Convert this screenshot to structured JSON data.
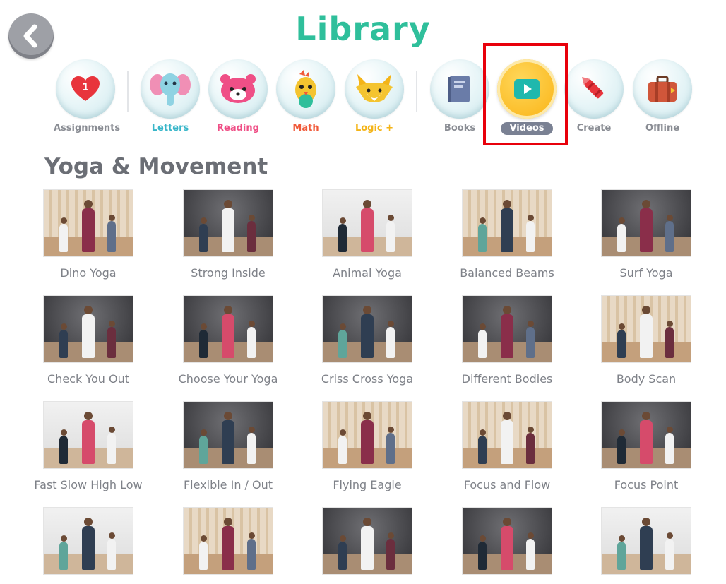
{
  "header": {
    "title": "Library",
    "back": {
      "icon": "back-arrow-icon"
    }
  },
  "nav": [
    {
      "key": "assignments",
      "label": "Assignments",
      "icon": "heart-badge-icon",
      "badge": "1",
      "color": "#8a8d94"
    },
    {
      "key": "letters",
      "label": "Letters",
      "icon": "elephant-icon",
      "color": "#38b6c9"
    },
    {
      "key": "reading",
      "label": "Reading",
      "icon": "red-panda-icon",
      "color": "#ef4f86"
    },
    {
      "key": "math",
      "label": "Math",
      "icon": "bird-icon",
      "color": "#f05a3a"
    },
    {
      "key": "logic",
      "label": "Logic +",
      "icon": "fox-icon",
      "color": "#f4b417"
    },
    {
      "key": "books",
      "label": "Books",
      "icon": "book-icon",
      "color": "#8a8d94"
    },
    {
      "key": "videos",
      "label": "Videos",
      "icon": "play-icon",
      "color": "#ffffff",
      "active": true
    },
    {
      "key": "create",
      "label": "Create",
      "icon": "crayon-icon",
      "color": "#8a8d94"
    },
    {
      "key": "offline",
      "label": "Offline",
      "icon": "suitcase-icon",
      "color": "#8a8d94"
    }
  ],
  "section": {
    "title": "Yoga & Movement"
  },
  "videos": [
    {
      "title": "Dino Yoga",
      "scene": "wood"
    },
    {
      "title": "Strong Inside",
      "scene": "dark"
    },
    {
      "title": "Animal Yoga",
      "scene": "light"
    },
    {
      "title": "Balanced Beams",
      "scene": "wood"
    },
    {
      "title": "Surf Yoga",
      "scene": "dark"
    },
    {
      "title": "Check You Out",
      "scene": "dark"
    },
    {
      "title": "Choose Your Yoga",
      "scene": "dark"
    },
    {
      "title": "Criss Cross Yoga",
      "scene": "dark"
    },
    {
      "title": "Different Bodies",
      "scene": "dark"
    },
    {
      "title": "Body Scan",
      "scene": "wood"
    },
    {
      "title": "Fast Slow High Low",
      "scene": "light"
    },
    {
      "title": "Flexible In / Out",
      "scene": "dark"
    },
    {
      "title": "Flying Eagle",
      "scene": "wood"
    },
    {
      "title": "Focus and Flow",
      "scene": "wood"
    },
    {
      "title": "Focus Point",
      "scene": "dark"
    },
    {
      "title": "",
      "scene": "light"
    },
    {
      "title": "",
      "scene": "wood"
    },
    {
      "title": "",
      "scene": "dark"
    },
    {
      "title": "",
      "scene": "dark"
    },
    {
      "title": "",
      "scene": "light"
    }
  ],
  "colors": {
    "title": "#2fbf9b",
    "active_bubble": "#fbbd28",
    "highlight": "#e8000b"
  }
}
